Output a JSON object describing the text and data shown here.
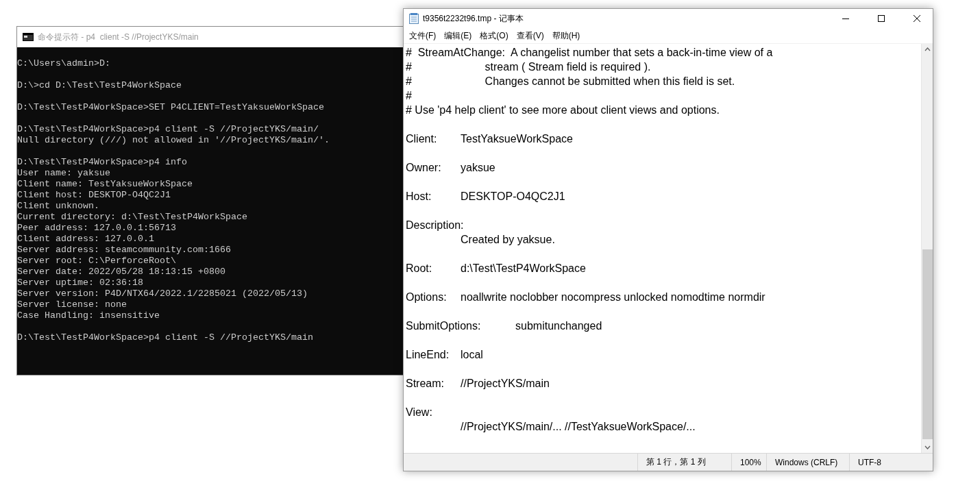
{
  "console_window": {
    "title": "命令提示符 - p4  client -S //ProjectYKS/main",
    "blocks": [
      [
        "C:\\Users\\admin>D:"
      ],
      [
        "D:\\>cd D:\\Test\\TestP4WorkSpace"
      ],
      [
        "D:\\Test\\TestP4WorkSpace>SET P4CLIENT=TestYaksueWorkSpace"
      ],
      [
        "D:\\Test\\TestP4WorkSpace>p4 client -S //ProjectYKS/main/",
        "Null directory (///) not allowed in '//ProjectYKS/main/'."
      ],
      [
        "D:\\Test\\TestP4WorkSpace>p4 info",
        "User name: yaksue",
        "Client name: TestYaksueWorkSpace",
        "Client host: DESKTOP-O4QC2J1",
        "Client unknown.",
        "Current directory: d:\\Test\\TestP4WorkSpace",
        "Peer address: 127.0.0.1:56713",
        "Client address: 127.0.0.1",
        "Server address: steamcommunity.com:1666",
        "Server root: C:\\PerforceRoot\\",
        "Server date: 2022/05/28 18:13:15 +0800",
        "Server uptime: 02:36:18",
        "Server version: P4D/NTX64/2022.1/2285021 (2022/05/13)",
        "Server license: none",
        "Case Handling: insensitive"
      ],
      [
        "D:\\Test\\TestP4WorkSpace>p4 client -S //ProjectYKS/main"
      ]
    ]
  },
  "notepad_window": {
    "title": "t9356t2232t96.tmp - 记事本",
    "menu": [
      "文件(F)",
      "编辑(E)",
      "格式(O)",
      "查看(V)",
      "帮助(H)"
    ],
    "blocks": [
      [
        "#  StreamAtChange:  A changelist number that sets a back-in-time view of a",
        "#                        stream ( Stream field is required ).",
        "#                        Changes cannot be submitted when this field is set.",
        "#",
        "# Use 'p4 help client' to see more about client views and options."
      ],
      [
        "Client:\tTestYaksueWorkSpace"
      ],
      [
        "Owner:\tyaksue"
      ],
      [
        "Host:\tDESKTOP-O4QC2J1"
      ],
      [
        "Description:",
        "\tCreated by yaksue."
      ],
      [
        "Root:\td:\\Test\\TestP4WorkSpace"
      ],
      [
        "Options:\tnoallwrite noclobber nocompress unlocked nomodtime normdir"
      ],
      [
        "SubmitOptions:\tsubmitunchanged"
      ],
      [
        "LineEnd:\tlocal"
      ],
      [
        "Stream:\t//ProjectYKS/main"
      ],
      [
        "View:",
        "\t//ProjectYKS/main/... //TestYaksueWorkSpace/..."
      ]
    ],
    "status_bar": [
      "第 1 行，第 1 列",
      "100%",
      "Windows (CRLF)",
      "UTF-8"
    ]
  }
}
